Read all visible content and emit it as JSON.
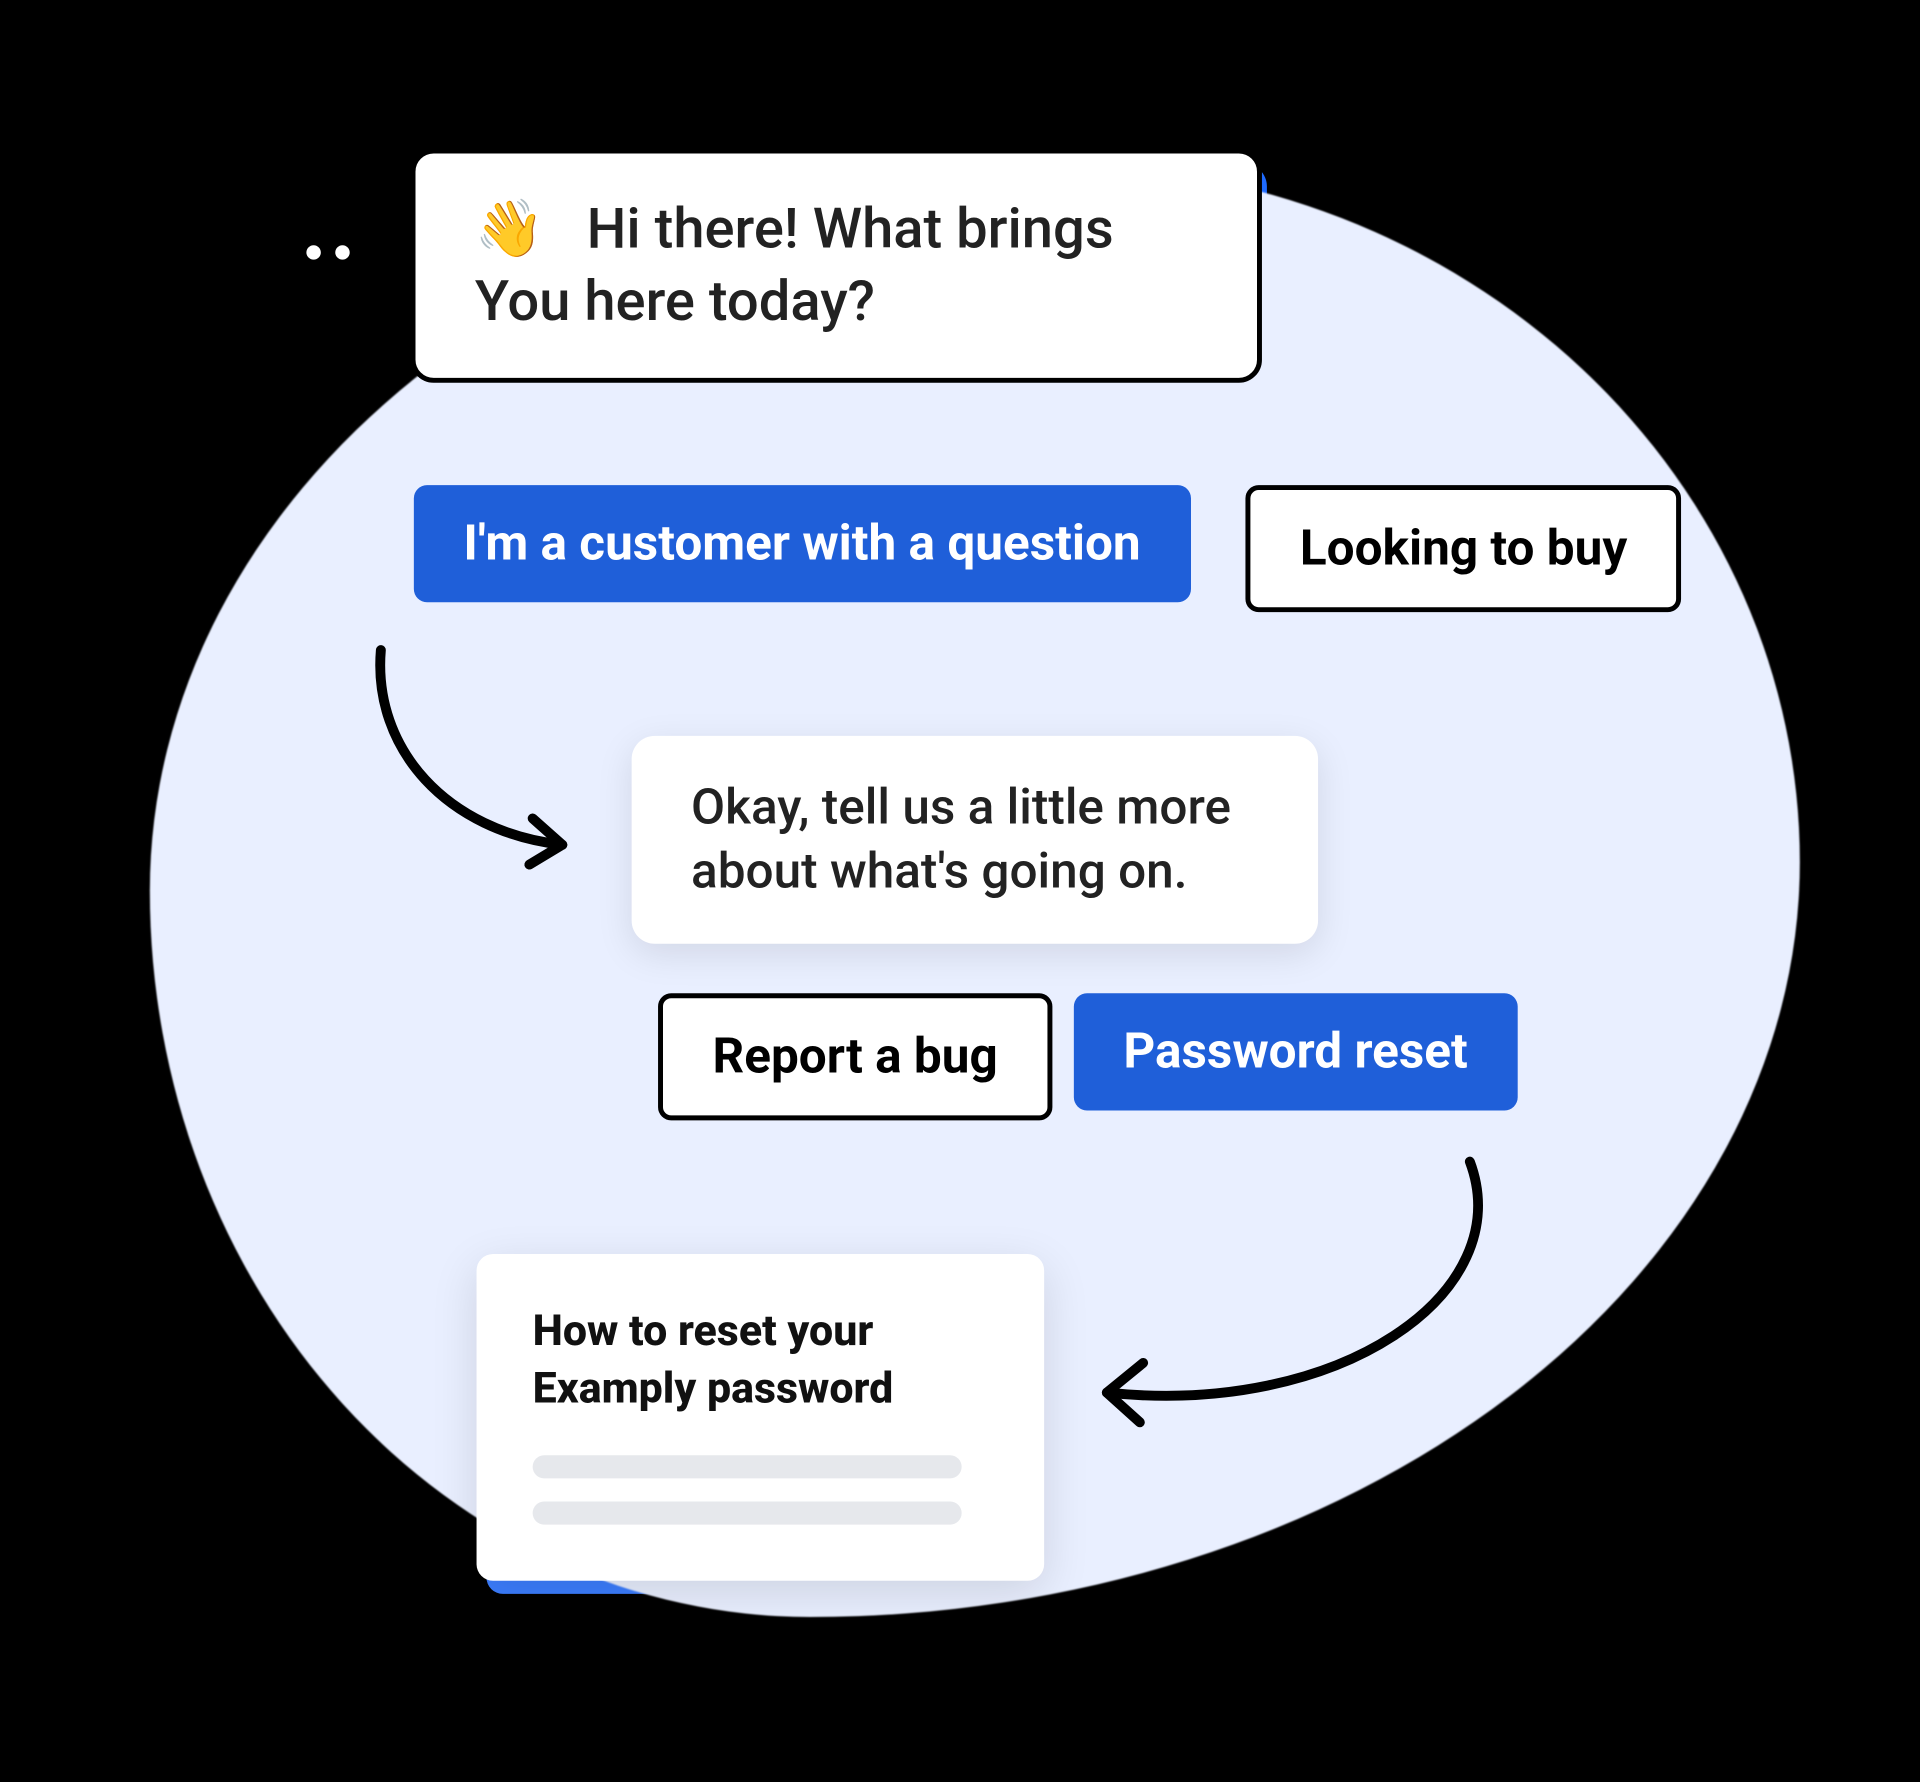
{
  "bot": {
    "greeting_emoji": "👋",
    "greeting_text": "Hi there! What brings You here today?"
  },
  "options_level1": {
    "customer": "I'm a customer with a question",
    "buy": "Looking to buy"
  },
  "followup": {
    "text": "Okay, tell us a little more about what's going on."
  },
  "options_level2": {
    "bug": "Report a bug",
    "password": "Password reset"
  },
  "article": {
    "title": "How to reset your Examply password"
  },
  "colors": {
    "primary": "#1F5FD9",
    "accent": "#3C7EFF",
    "blob": "#E9EFFF"
  }
}
